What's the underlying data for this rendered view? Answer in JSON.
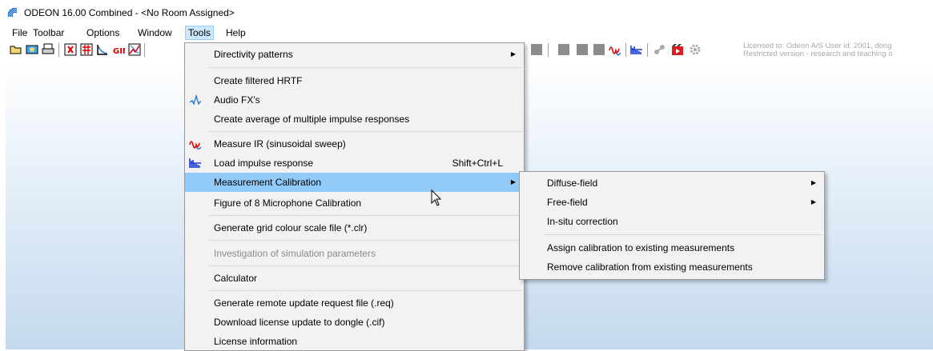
{
  "window": {
    "title": "ODEON 16.00 Combined - <No Room Assigned>"
  },
  "menubar": {
    "items": [
      "File",
      "Toolbar",
      "Options",
      "Window",
      "Tools",
      "Help"
    ]
  },
  "toolbar": {
    "license_line1": "Licensed to: Odeon A/S   User id: 2001, dong",
    "license_line2": "Restricted version - research and teaching o"
  },
  "tools_menu": {
    "items": [
      {
        "label": "Directivity patterns",
        "submenu": true
      },
      {
        "label": "Create filtered HRTF"
      },
      {
        "label": "Audio FX's",
        "icon": "audio-fx-icon"
      },
      {
        "label": "Create average of multiple impulse responses"
      },
      {
        "label": "Measure IR (sinusoidal sweep)",
        "icon": "measure-ir-icon"
      },
      {
        "label": "Load impulse response",
        "icon": "impulse-response-icon",
        "shortcut": "Shift+Ctrl+L"
      },
      {
        "label": "Measurement Calibration",
        "submenu": true,
        "highlighted": true
      },
      {
        "label": "Figure of 8 Microphone Calibration"
      },
      {
        "label": "Generate grid colour scale file (*.clr)"
      },
      {
        "label": "Investigation of simulation parameters",
        "disabled": true
      },
      {
        "label": "Calculator"
      },
      {
        "label": "Generate remote update request file  (.req)"
      },
      {
        "label": "Download license update to dongle (.cif)"
      },
      {
        "label": "License information"
      }
    ]
  },
  "calibration_submenu": {
    "items": [
      {
        "label": "Diffuse-field",
        "submenu": true
      },
      {
        "label": "Free-field",
        "submenu": true
      },
      {
        "label": "In-situ correction"
      },
      {
        "label": "Assign calibration to existing measurements"
      },
      {
        "label": "Remove calibration from existing measurements"
      }
    ]
  },
  "colors": {
    "highlight": "#91c9f7",
    "menu_bg": "#f2f2f2",
    "workspace_bottom": "#c4d9ee"
  }
}
